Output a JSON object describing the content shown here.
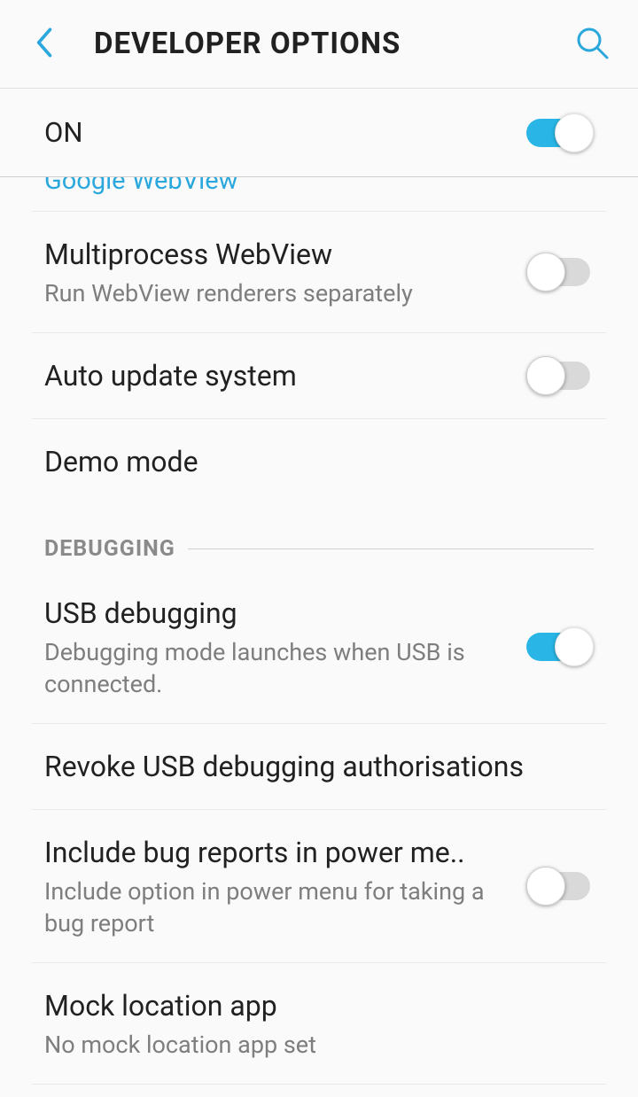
{
  "header": {
    "title": "DEVELOPER OPTIONS"
  },
  "master": {
    "label": "ON",
    "enabled": true
  },
  "partial_row": {
    "text": "Google WebView"
  },
  "rows": {
    "multiprocess": {
      "title": "Multiprocess WebView",
      "sub": "Run WebView renderers separately",
      "enabled": false
    },
    "auto_update": {
      "title": "Auto update system",
      "enabled": false
    },
    "demo_mode": {
      "title": "Demo mode"
    }
  },
  "sections": {
    "debugging": "DEBUGGING"
  },
  "debug_rows": {
    "usb_debug": {
      "title": "USB debugging",
      "sub": "Debugging mode launches when USB is connected.",
      "enabled": true
    },
    "revoke": {
      "title": "Revoke USB debugging authorisations"
    },
    "bug_reports": {
      "title": "Include bug reports in power me..",
      "sub": "Include option in power menu for taking a bug report",
      "enabled": false
    },
    "mock_loc": {
      "title": "Mock location app",
      "sub": "No mock location app set"
    }
  },
  "colors": {
    "accent": "#29b6e6"
  }
}
